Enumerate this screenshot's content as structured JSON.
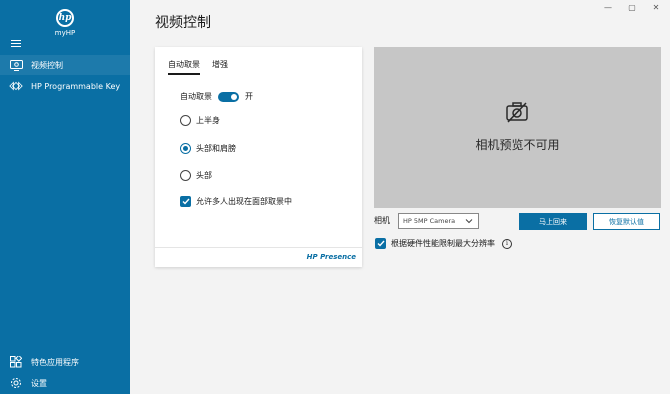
{
  "app": {
    "name": "myHP",
    "logo_text": "hp"
  },
  "sidebar": {
    "items": [
      {
        "label": "视频控制",
        "icon": "camera-monitor-icon"
      },
      {
        "label": "HP Programmable Key",
        "icon": "programmable-key-icon"
      }
    ],
    "bottom_items": [
      {
        "label": "特色应用程序",
        "icon": "apps-grid-icon"
      },
      {
        "label": "设置",
        "icon": "gear-icon"
      }
    ]
  },
  "window_controls": {
    "minimize": "—",
    "maximize": "▢",
    "close": "✕"
  },
  "page": {
    "title": "视频控制"
  },
  "tabs": [
    {
      "label": "自动取景",
      "active": true
    },
    {
      "label": "增强",
      "active": false
    }
  ],
  "auto_framing": {
    "label": "自动取景",
    "toggle_state": "开"
  },
  "options": [
    {
      "label": "上半身",
      "checked": false
    },
    {
      "label": "头部和肩膀",
      "checked": true
    },
    {
      "label": "头部",
      "checked": false
    }
  ],
  "multi_person": {
    "label": "允许多人出现在面部取景中",
    "checked": true
  },
  "branding": {
    "presence": "HP Presence"
  },
  "preview": {
    "unavailable_text": "相机预览不可用"
  },
  "camera": {
    "label": "相机",
    "selected": "HP 5MP Camera",
    "apply_button": "马上回来",
    "reset_button": "恢复默认值"
  },
  "hardware_limit": {
    "label": "根据硬件性能限制最大分辨率",
    "checked": true
  },
  "colors": {
    "brand": "#0a6fa4",
    "preview_bg": "#c6c6c6",
    "page_bg": "#f3f3f3"
  }
}
